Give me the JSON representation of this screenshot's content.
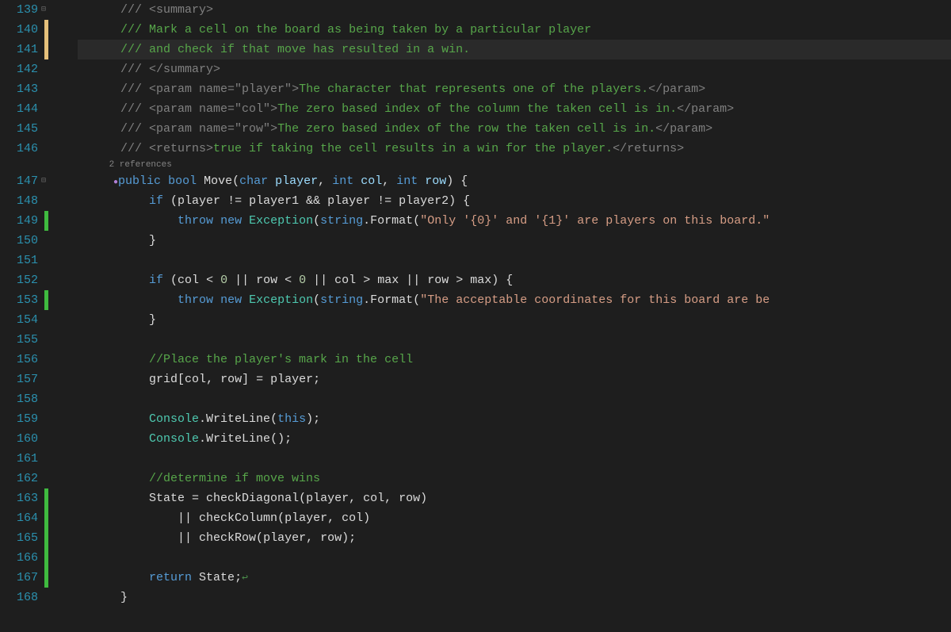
{
  "lines": [
    {
      "n": "139",
      "fold": "⊟",
      "mark": "",
      "text": ""
    },
    {
      "n": "140",
      "fold": "",
      "mark": "yellow",
      "text": ""
    },
    {
      "n": "141",
      "fold": "",
      "mark": "yellow",
      "text": "",
      "hl": true
    },
    {
      "n": "142",
      "fold": "",
      "mark": "",
      "text": ""
    },
    {
      "n": "143",
      "fold": "",
      "mark": "",
      "text": ""
    },
    {
      "n": "144",
      "fold": "",
      "mark": "",
      "text": ""
    },
    {
      "n": "145",
      "fold": "",
      "mark": "",
      "text": ""
    },
    {
      "n": "146",
      "fold": "",
      "mark": "",
      "text": ""
    },
    {
      "n": "147",
      "fold": "⊟",
      "mark": "",
      "text": ""
    },
    {
      "n": "148",
      "fold": "",
      "mark": "",
      "text": ""
    },
    {
      "n": "149",
      "fold": "",
      "mark": "green",
      "text": ""
    },
    {
      "n": "150",
      "fold": "",
      "mark": "",
      "text": ""
    },
    {
      "n": "151",
      "fold": "",
      "mark": "",
      "text": ""
    },
    {
      "n": "152",
      "fold": "",
      "mark": "",
      "text": ""
    },
    {
      "n": "153",
      "fold": "",
      "mark": "green",
      "text": ""
    },
    {
      "n": "154",
      "fold": "",
      "mark": "",
      "text": ""
    },
    {
      "n": "155",
      "fold": "",
      "mark": "",
      "text": ""
    },
    {
      "n": "156",
      "fold": "",
      "mark": "",
      "text": ""
    },
    {
      "n": "157",
      "fold": "",
      "mark": "",
      "text": ""
    },
    {
      "n": "158",
      "fold": "",
      "mark": "",
      "text": ""
    },
    {
      "n": "159",
      "fold": "",
      "mark": "",
      "text": ""
    },
    {
      "n": "160",
      "fold": "",
      "mark": "",
      "text": ""
    },
    {
      "n": "161",
      "fold": "",
      "mark": "",
      "text": ""
    },
    {
      "n": "162",
      "fold": "",
      "mark": "",
      "text": ""
    },
    {
      "n": "163",
      "fold": "",
      "mark": "green",
      "text": ""
    },
    {
      "n": "164",
      "fold": "",
      "mark": "green",
      "text": ""
    },
    {
      "n": "165",
      "fold": "",
      "mark": "green",
      "text": ""
    },
    {
      "n": "166",
      "fold": "",
      "mark": "green",
      "text": ""
    },
    {
      "n": "167",
      "fold": "",
      "mark": "green",
      "text": ""
    },
    {
      "n": "168",
      "fold": "",
      "mark": "",
      "text": ""
    }
  ],
  "codelens": "2 references",
  "doc": {
    "summary_open": "/// <summary>",
    "summary_line1": "/// Mark a cell on the board as being taken by a particular player",
    "summary_line2": "/// and check if that move has resulted in a win.",
    "summary_close": "/// </summary>",
    "param_player_open": "/// <param name=",
    "param_player_name": "\"player\"",
    "param_player_mid": ">",
    "param_player_text": "The character that represents one of the players.",
    "param_player_close": "</param>",
    "param_col_name": "\"col\"",
    "param_col_text": "The zero based index of the column the taken cell is in.",
    "param_row_name": "\"row\"",
    "param_row_text": "The zero based index of the row the taken cell is in.",
    "returns_open": "/// <returns>",
    "returns_text": "true if taking the cell results in a win for the player.",
    "returns_close": "</returns>"
  },
  "code": {
    "kw_public": "public",
    "kw_bool": "bool",
    "method_move": "Move",
    "kw_char": "char",
    "p_player": "player",
    "kw_int": "int",
    "p_col": "col",
    "p_row": "row",
    "kw_if": "if",
    "v_player1": "player1",
    "v_player2": "player2",
    "kw_throw": "throw",
    "kw_new": "new",
    "t_exception": "Exception",
    "kw_string": "string",
    "m_format": "Format",
    "str_only": "\"Only '{0}' and '{1}' are players on this board.\"",
    "n_zero": "0",
    "v_max": "max",
    "str_accept": "\"The acceptable coordinates for this board are be",
    "cmt_place": "//Place the player's mark in the cell",
    "v_grid": "grid",
    "t_console": "Console",
    "m_writeline": "WriteLine",
    "kw_this": "this",
    "cmt_determine": "//determine if move wins",
    "v_state": "State",
    "m_checkdiag": "checkDiagonal",
    "m_checkcol": "checkColumn",
    "m_checkrow": "checkRow",
    "kw_return": "return"
  }
}
